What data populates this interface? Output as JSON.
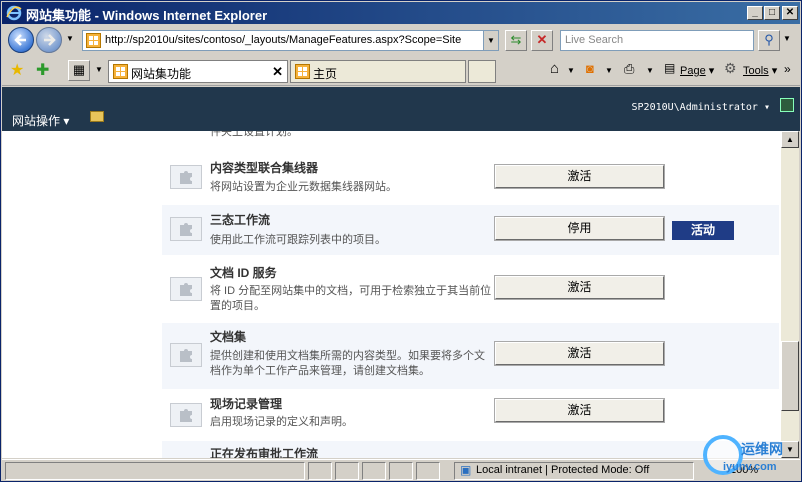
{
  "window": {
    "title": "网站集功能 - Windows Internet Explorer",
    "minimize": "_",
    "maximize": "□",
    "close": "✕"
  },
  "address": {
    "url": "http://sp2010u/sites/contoso/_layouts/ManageFeatures.aspx?Scope=Site",
    "search_placeholder": "Live Search"
  },
  "tabs": [
    {
      "label": "网站集功能",
      "active": true
    },
    {
      "label": "主页",
      "active": false
    }
  ],
  "toolbar": {
    "page_label": "Page",
    "tools_label": "Tools"
  },
  "sharepoint": {
    "site_actions": "网站操作 ▾",
    "user": "SP2010U\\Administrator ▾"
  },
  "features": [
    {
      "name": "",
      "desc": "件夹上设置计划。",
      "button": "",
      "status": ""
    },
    {
      "name": "内容类型联合集线器",
      "desc": "将网站设置为企业元数据集线器网站。",
      "button": "激活",
      "status": ""
    },
    {
      "name": "三态工作流",
      "desc": "使用此工作流可跟踪列表中的项目。",
      "button": "停用",
      "status": "活动"
    },
    {
      "name": "文档 ID 服务",
      "desc": "将 ID 分配至网站集中的文档，可用于检索独立于其当前位置的项目。",
      "button": "激活",
      "status": ""
    },
    {
      "name": "文档集",
      "desc": "提供创建和使用文档集所需的内容类型。如果要将多个文档作为单个工作产品来管理，请创建文档集。",
      "button": "激活",
      "status": ""
    },
    {
      "name": "现场记录管理",
      "desc": "启用现场记录的定义和声明。",
      "button": "激活",
      "status": ""
    },
    {
      "name": "正在发布审批工作流",
      "desc": "",
      "button": "",
      "status": ""
    }
  ],
  "statusbar": {
    "zone": "Local intranet | Protected Mode: Off",
    "zoom": "100%"
  },
  "watermark": {
    "line1": "运维网",
    "line2": "iyunv.com"
  },
  "colors": {
    "titlebar": "#0a246a",
    "sp_bar": "#21374c",
    "status_badge": "#1f3c86"
  }
}
